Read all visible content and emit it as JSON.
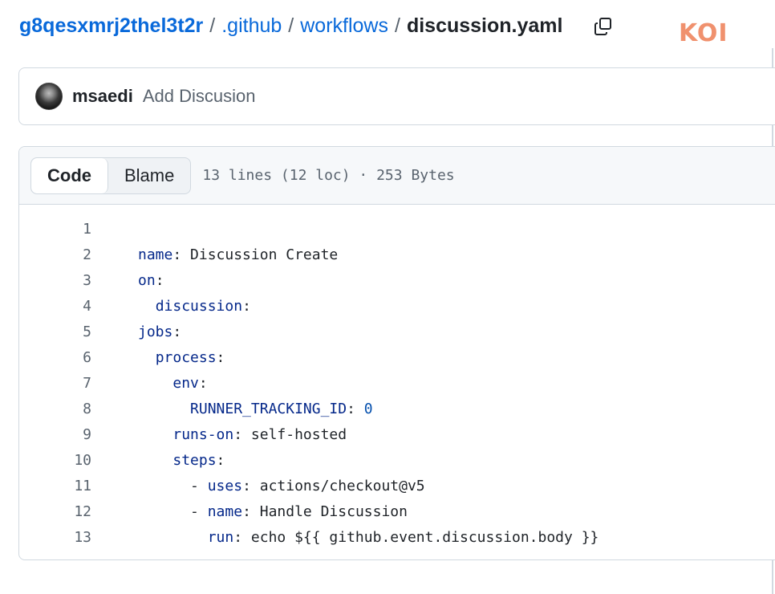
{
  "breadcrumb": {
    "repo": "g8qesxmrj2thel3t2r",
    "separator": "/",
    "folders": [
      ".github",
      "workflows"
    ],
    "file": "discussion.yaml"
  },
  "copy_icon": "copy-icon",
  "brand": {
    "logo_text": "KOI",
    "color": "#f0916e"
  },
  "commit": {
    "author": "msaedi",
    "message": "Add Discusion"
  },
  "file_view": {
    "tabs": [
      "Code",
      "Blame"
    ],
    "active_tab": "Code",
    "meta": "13 lines (12 loc) · 253 Bytes"
  },
  "code_lines": [
    {
      "num": "1",
      "indent": "",
      "key": "",
      "rest": ""
    },
    {
      "num": "2",
      "indent": "",
      "key": "name",
      "rest": ": Discussion Create"
    },
    {
      "num": "3",
      "indent": "",
      "key": "on",
      "rest": ":"
    },
    {
      "num": "4",
      "indent": "  ",
      "key": "discussion",
      "rest": ":"
    },
    {
      "num": "5",
      "indent": "",
      "key": "jobs",
      "rest": ":"
    },
    {
      "num": "6",
      "indent": "  ",
      "key": "process",
      "rest": ":"
    },
    {
      "num": "7",
      "indent": "    ",
      "key": "env",
      "rest": ":"
    },
    {
      "num": "8",
      "indent": "      ",
      "key": "RUNNER_TRACKING_ID",
      "rest": ": ",
      "num_val": "0"
    },
    {
      "num": "9",
      "indent": "    ",
      "key": "runs-on",
      "rest": ": self-hosted"
    },
    {
      "num": "10",
      "indent": "    ",
      "key": "steps",
      "rest": ":"
    },
    {
      "num": "11",
      "indent": "      - ",
      "key": "uses",
      "rest": ": actions/checkout@v5"
    },
    {
      "num": "12",
      "indent": "      - ",
      "key": "name",
      "rest": ": Handle Discussion"
    },
    {
      "num": "13",
      "indent": "        ",
      "key": "run",
      "rest": ": echo ${{ github.event.discussion.body }}"
    }
  ],
  "colors": {
    "link": "#0969da",
    "yaml_key": "#05288a",
    "line_number": "#59636e"
  }
}
